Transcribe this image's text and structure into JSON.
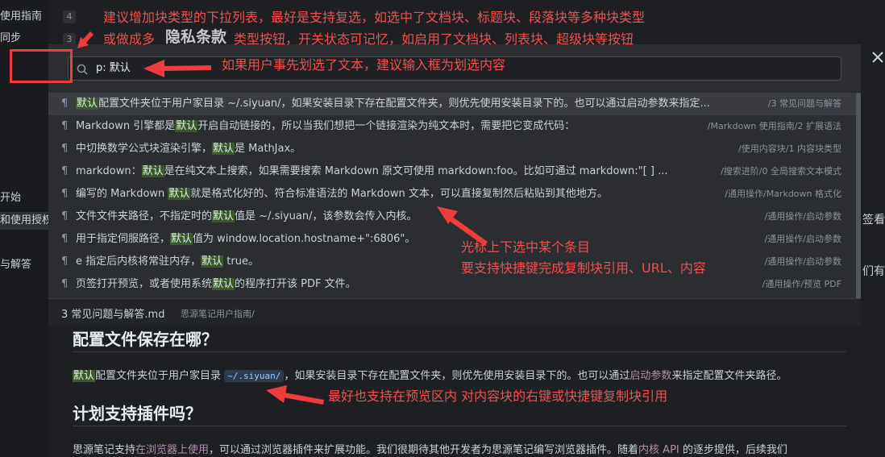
{
  "sidebar": {
    "items": [
      {
        "label": "使用指南",
        "count": "4"
      },
      {
        "label": "同步",
        "count": "3"
      },
      {
        "label": "开始"
      },
      {
        "label": "和使用授权"
      },
      {
        "label": "与解答"
      }
    ]
  },
  "right_edge": {
    "t1": "签看",
    "t2": "们有"
  },
  "search": {
    "value": "p: 默认"
  },
  "results": [
    {
      "pre": "",
      "hl": "默认",
      "post": "配置文件夹位于用户家目录 ~/.siyuan/，如果安装目录下存在配置文件夹，则优先使用安装目录下的。也可以通过启动参数来指定...",
      "path": "/3 常见问题与解答"
    },
    {
      "pre": "Markdown 引擎都是",
      "hl": "默认",
      "post": "开启自动链接的，所以当我们想把一个链接渲染为纯文本时，需要把它变成代码：",
      "path": "/Markdown 使用指南/2 扩展语法"
    },
    {
      "pre": "中切换数学公式块渲染引擎，",
      "hl": "默认",
      "post": "是 MathJax。",
      "path": "/使用内容块/1 内容块类型"
    },
    {
      "pre": "markdown：",
      "hl": "默认",
      "post": "是在纯文本上搜索，如果需要搜索 Markdown 原文可使用 markdown:foo。比如可通过 markdown:\"[ ] ...",
      "path": "/搜索进阶/0 全局搜索文本模式"
    },
    {
      "pre": "编写的 Markdown ",
      "hl": "默认",
      "post": "就是格式化好的、符合标准语法的 Markdown 文本，可以直接复制然后粘贴到其他地方。",
      "path": "/通用操作/Markdown 格式化"
    },
    {
      "pre": "文件文件夹路径，不指定时的",
      "hl": "默认",
      "post": "值是 ~/.siyuan/，该参数会传入内核。",
      "path": "/通用操作/启动参数"
    },
    {
      "pre": "用于指定伺服路径，",
      "hl": "默认",
      "post": "值为 window.location.hostname+\":6806\"。",
      "path": "/通用操作/启动参数"
    },
    {
      "pre": "e 指定后内核将常驻内存，",
      "hl": "默认",
      "post": " true。",
      "path": "/通用操作/启动参数"
    },
    {
      "pre": "页签打开预览，或者使用系统",
      "hl": "默认",
      "post": "的程序打开该 PDF 文件。",
      "path": "/通用操作/预览 PDF"
    }
  ],
  "footer": {
    "file": "3 常见问题与解答.md",
    "path": "思源笔记用户指南/"
  },
  "preview": {
    "heading1": "配置文件保存在哪？",
    "p1_hl": "默认",
    "p1_a": "配置文件夹位于用户家目录",
    "p1_code": "~/.siyuan/",
    "p1_b": "，如果安装目录下存在配置文件夹，则优先使用安装目录下的。也可以通过",
    "p1_link": "启动参数",
    "p1_c": "来指定配置文件夹路径。",
    "heading2": "计划支持插件吗？",
    "p2_a": "思源笔记支持",
    "p2_link1": "在浏览器上使用",
    "p2_b": "，可以通过浏览器插件来扩展功能。我们很期待其他开发者为思源笔记编写浏览器插件。随着",
    "p2_link2": "内核 API",
    "p2_c": " 的逐步提供，后续我们"
  },
  "annotations": {
    "top1": "建议增加块类型的下拉列表，最好是支持复选，如选中了文档块、标题块、段落块等多种块类型",
    "top2_a": "或做成多",
    "top2_big": "隐私条款",
    "top2_b": "类型按钮，开关状态可记忆，如启用了文档块、列表块、超级块等按钮",
    "search_note": "如果用户事先划选了文本，建议输入框为划选内容",
    "mid1": "光标上下选中某个条目",
    "mid2": "要支持快捷键完成复制块引用、URL、内容",
    "bottom": "最好也支持在预览区内 对内容块的右键或快捷键复制块引用"
  },
  "colors": {
    "annotation": "#f05050",
    "highlight": "#3a5a2a",
    "dialog": "#2b2d31"
  }
}
